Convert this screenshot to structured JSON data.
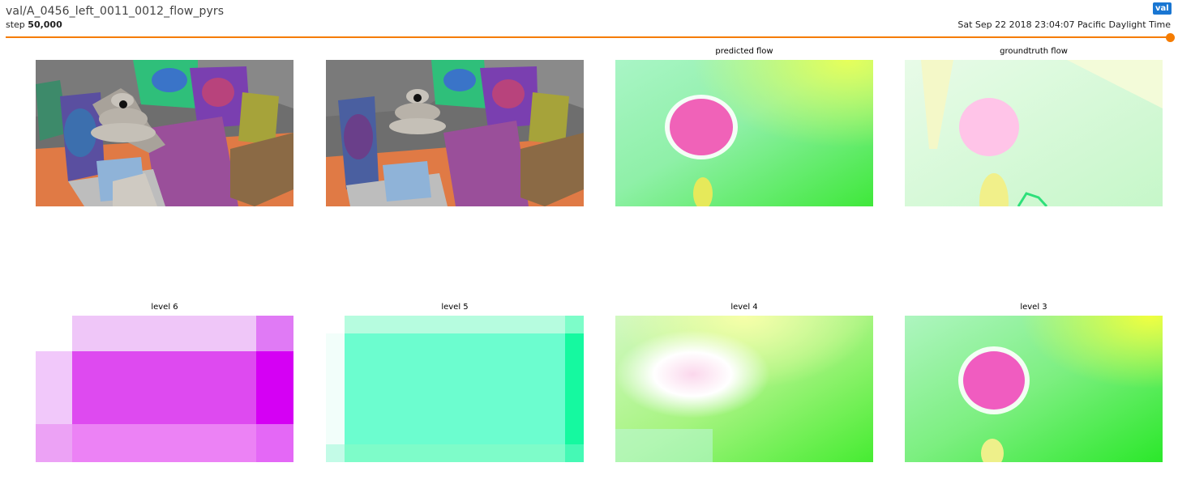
{
  "header": {
    "title": "val/A_0456_left_0011_0012_flow_pyrs",
    "step_label": "step",
    "step_value": "50,000",
    "run_tag": "val",
    "timestamp": "Sat Sep 22 2018 23:04:07 Pacific Daylight Time"
  },
  "slider": {
    "progress": 1.0
  },
  "panels": {
    "predicted_flow": "predicted flow",
    "groundtruth_flow": "groundtruth flow",
    "level6": "level 6",
    "level5": "level 5",
    "level4": "level 4",
    "level3": "level 3"
  },
  "colors": {
    "accent": "#f57c00",
    "run_tag_bg": "#1976d2"
  }
}
